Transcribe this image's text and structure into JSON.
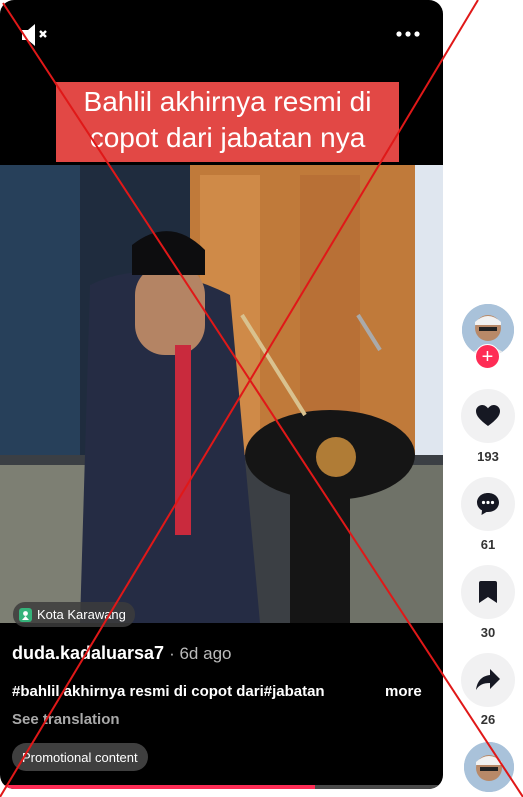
{
  "video": {
    "overlay_title": "Bahlil akhirnya resmi di copot dari jabatan nya",
    "location": "Kota Karawang",
    "author": "duda.kadaluarsa7",
    "time_ago": "· 6d ago",
    "caption": "#bahlil akhirnya resmi di copot dari#jabatan",
    "more_label": "more",
    "translate_label": "See translation",
    "promo_label": "Promotional content",
    "progress_fraction": 0.71
  },
  "icons": {
    "mute": "muted-speaker-icon",
    "more": "more-dots-icon",
    "location": "location-pin-icon",
    "like": "heart-icon",
    "comment": "comment-icon",
    "favorite": "bookmark-icon",
    "share": "share-arrow-icon"
  },
  "sidebar": {
    "follow_label": "+",
    "likes": "193",
    "comments": "61",
    "saves": "30",
    "shares": "26"
  },
  "colors": {
    "accent": "#fe2c55",
    "overlay_title_bg": "#e24845",
    "cross_lines": "#e01818"
  }
}
